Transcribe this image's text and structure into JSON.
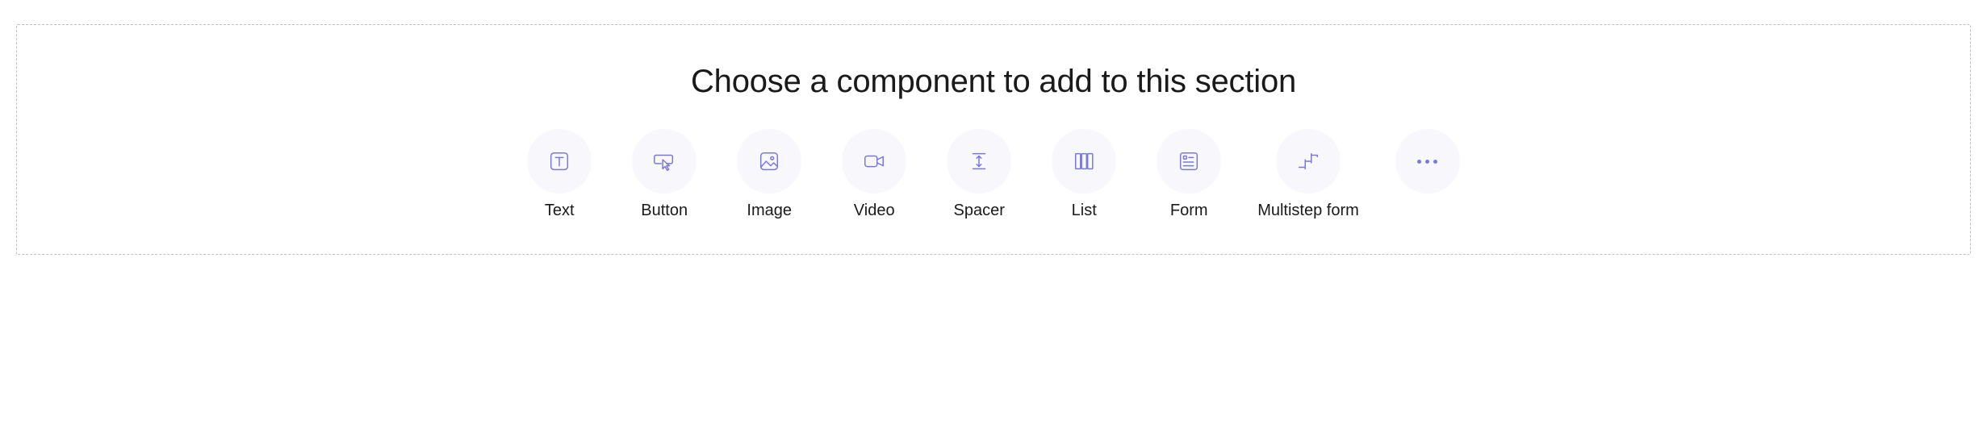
{
  "heading": "Choose a component to add to this section",
  "components": {
    "text": {
      "label": "Text",
      "icon": "text-icon"
    },
    "button": {
      "label": "Button",
      "icon": "button-icon"
    },
    "image": {
      "label": "Image",
      "icon": "image-icon"
    },
    "video": {
      "label": "Video",
      "icon": "video-icon"
    },
    "spacer": {
      "label": "Spacer",
      "icon": "spacer-icon"
    },
    "list": {
      "label": "List",
      "icon": "list-icon"
    },
    "form": {
      "label": "Form",
      "icon": "form-icon"
    },
    "multistep_form": {
      "label": "Multistep form",
      "icon": "multistep-form-icon"
    }
  },
  "more": {
    "icon": "more-icon"
  },
  "colors": {
    "icon": "#7a7ad6",
    "icon_bg": "#f8f7fc",
    "border": "#bfbfbf",
    "text": "#1a1a1a"
  }
}
